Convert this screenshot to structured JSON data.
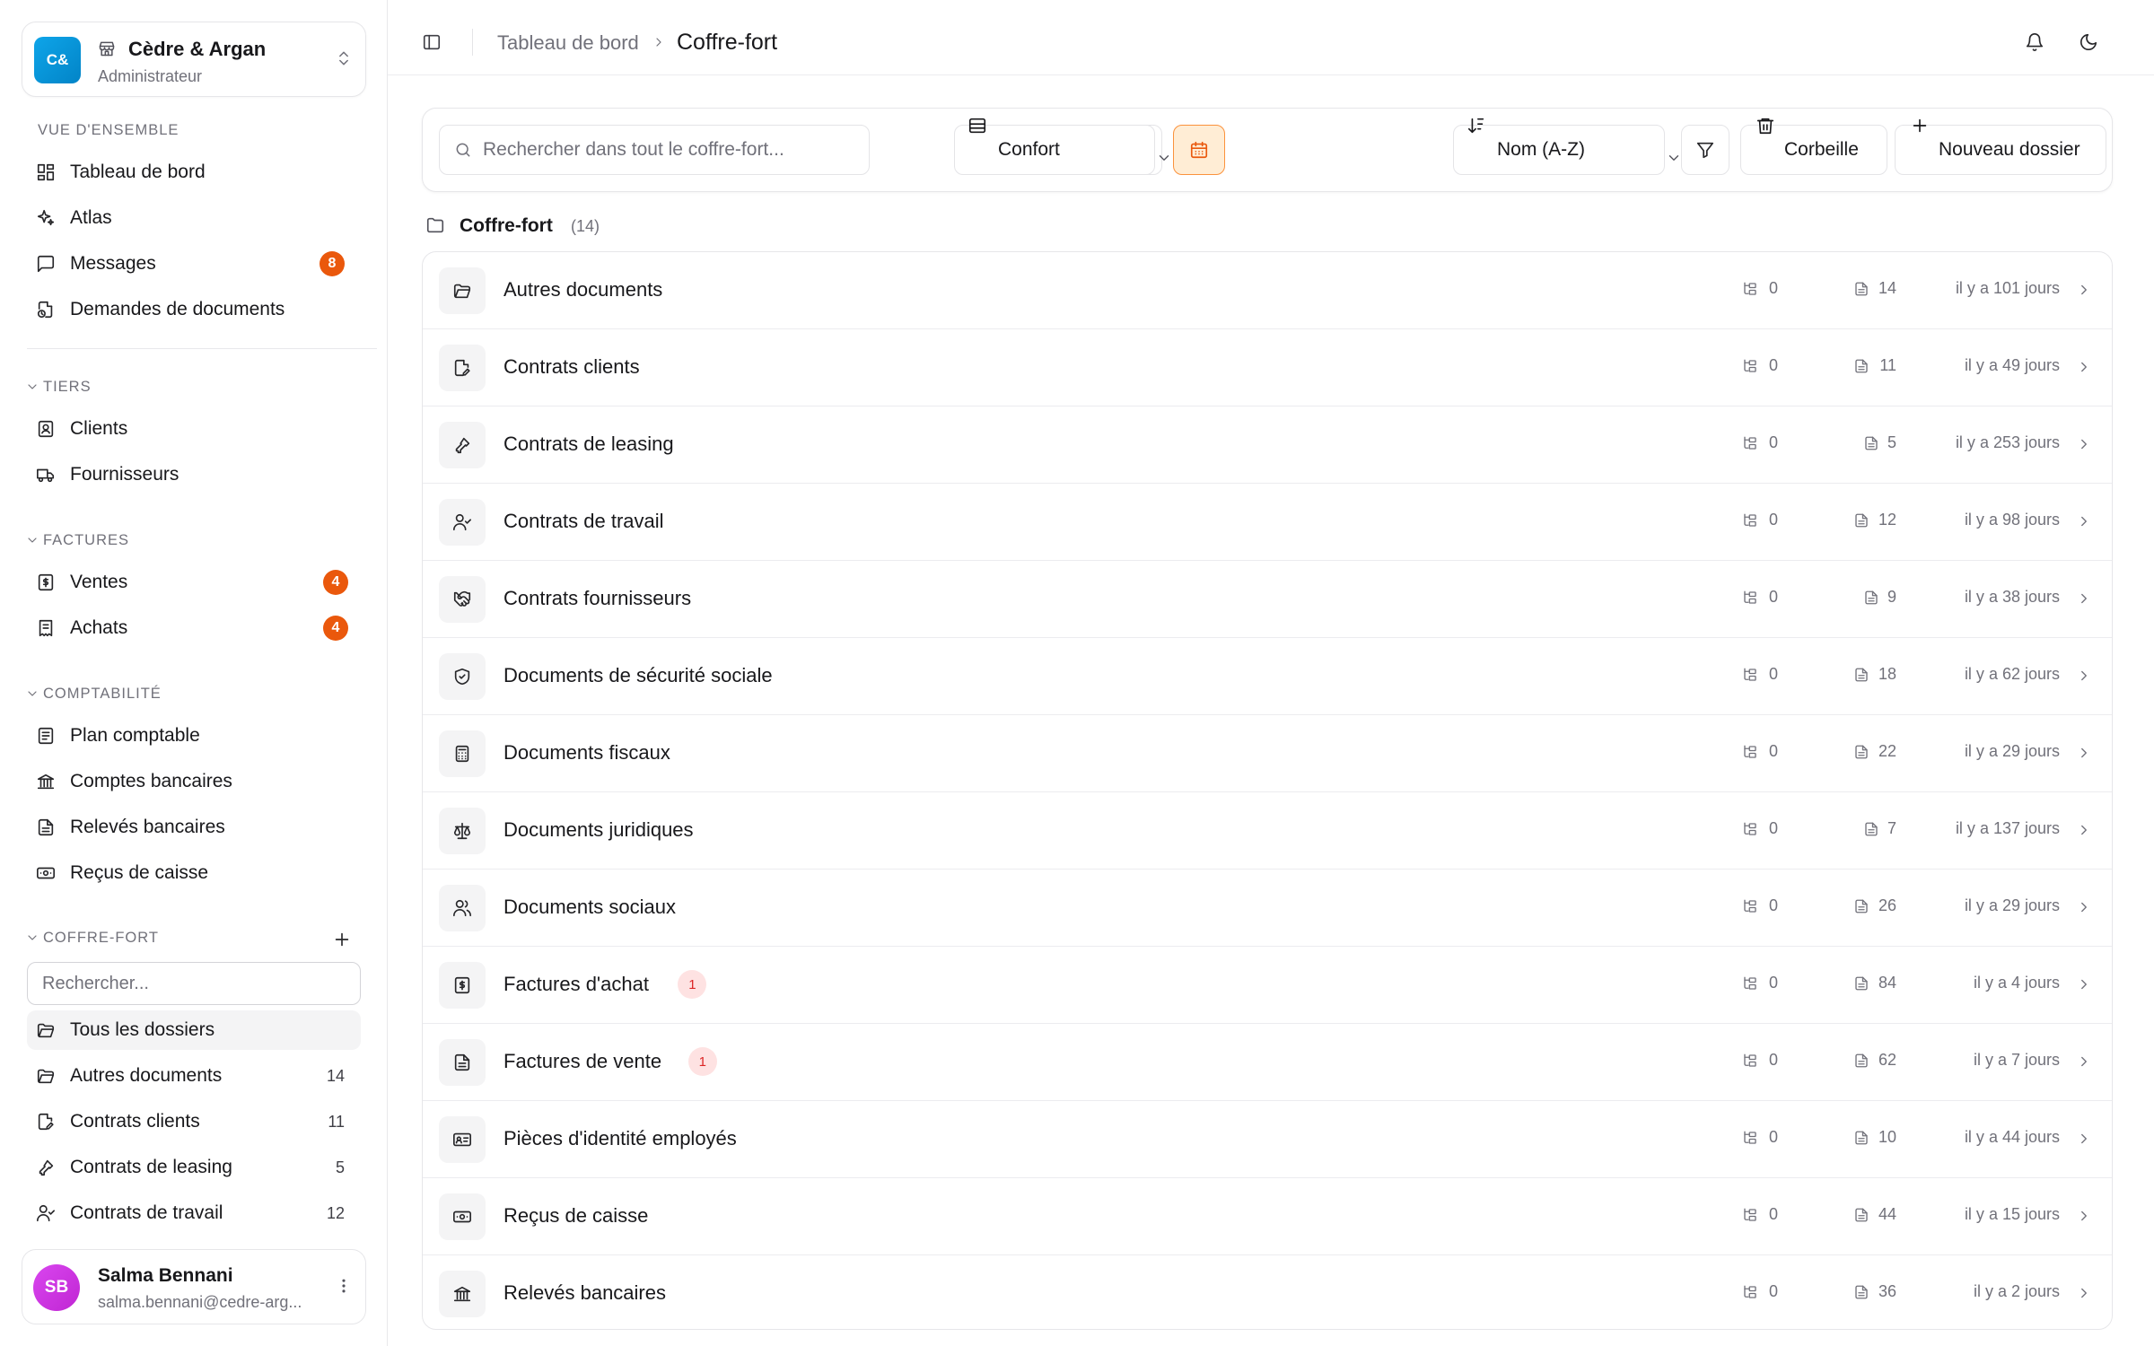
{
  "org": {
    "logo": "C&",
    "name": "Cèdre & Argan",
    "role": "Administrateur"
  },
  "sections": {
    "overview": "VUE D'ENSEMBLE",
    "tiers": "TIERS",
    "factures": "FACTURES",
    "comptabilite": "COMPTABILITÉ",
    "coffre": "COFFRE-FORT"
  },
  "nav": {
    "dashboard": "Tableau de bord",
    "atlas": "Atlas",
    "messages": "Messages",
    "messages_badge": "8",
    "demandes": "Demandes de documents",
    "clients": "Clients",
    "fournisseurs": "Fournisseurs",
    "ventes": "Ventes",
    "ventes_badge": "4",
    "achats": "Achats",
    "achats_badge": "4",
    "plan": "Plan comptable",
    "comptes": "Comptes bancaires",
    "releves": "Relevés bancaires",
    "recus": "Reçus de caisse"
  },
  "vault_nav": {
    "search_placeholder": "Rechercher...",
    "all": "Tous les dossiers",
    "items": [
      {
        "label": "Autres documents",
        "count": "14",
        "icon": "folder-open-icon"
      },
      {
        "label": "Contrats clients",
        "count": "11",
        "icon": "file-signature-icon"
      },
      {
        "label": "Contrats de leasing",
        "count": "5",
        "icon": "key-icon"
      },
      {
        "label": "Contrats de travail",
        "count": "12",
        "icon": "user-check-icon"
      }
    ]
  },
  "user": {
    "initials": "SB",
    "name": "Salma Bennani",
    "email": "salma.bennani@cedre-arg..."
  },
  "header": {
    "crumb_parent": "Tableau de bord",
    "crumb_current": "Coffre-fort"
  },
  "toolbar": {
    "search_placeholder": "Rechercher dans tout le coffre-fort...",
    "density": "Confort",
    "sort": "Nom (A-Z)",
    "trash": "Corbeille",
    "new_folder": "Nouveau dossier"
  },
  "folder_heading": {
    "title": "Coffre-fort",
    "count": "(14)"
  },
  "folders": [
    {
      "name": "Autres documents",
      "icon": "folder-open-icon",
      "subfolders": "0",
      "docs": "14",
      "updated": "il y a 101 jours",
      "badge": ""
    },
    {
      "name": "Contrats clients",
      "icon": "file-signature-icon",
      "subfolders": "0",
      "docs": "11",
      "updated": "il y a 49 jours",
      "badge": ""
    },
    {
      "name": "Contrats de leasing",
      "icon": "key-icon",
      "subfolders": "0",
      "docs": "5",
      "updated": "il y a 253 jours",
      "badge": ""
    },
    {
      "name": "Contrats de travail",
      "icon": "user-check-icon",
      "subfolders": "0",
      "docs": "12",
      "updated": "il y a 98 jours",
      "badge": ""
    },
    {
      "name": "Contrats fournisseurs",
      "icon": "handshake-icon",
      "subfolders": "0",
      "docs": "9",
      "updated": "il y a 38 jours",
      "badge": ""
    },
    {
      "name": "Documents de sécurité sociale",
      "icon": "shield-icon",
      "subfolders": "0",
      "docs": "18",
      "updated": "il y a 62 jours",
      "badge": ""
    },
    {
      "name": "Documents fiscaux",
      "icon": "calculator-icon",
      "subfolders": "0",
      "docs": "22",
      "updated": "il y a 29 jours",
      "badge": ""
    },
    {
      "name": "Documents juridiques",
      "icon": "scale-icon",
      "subfolders": "0",
      "docs": "7",
      "updated": "il y a 137 jours",
      "badge": ""
    },
    {
      "name": "Documents sociaux",
      "icon": "users-icon",
      "subfolders": "0",
      "docs": "26",
      "updated": "il y a 29 jours",
      "badge": ""
    },
    {
      "name": "Factures d'achat",
      "icon": "receipt-dollar-icon",
      "subfolders": "0",
      "docs": "84",
      "updated": "il y a 4 jours",
      "badge": "1"
    },
    {
      "name": "Factures de vente",
      "icon": "file-text-icon",
      "subfolders": "0",
      "docs": "62",
      "updated": "il y a 7 jours",
      "badge": "1"
    },
    {
      "name": "Pièces d'identité employés",
      "icon": "id-card-icon",
      "subfolders": "0",
      "docs": "10",
      "updated": "il y a 44 jours",
      "badge": ""
    },
    {
      "name": "Reçus de caisse",
      "icon": "banknote-icon",
      "subfolders": "0",
      "docs": "44",
      "updated": "il y a 15 jours",
      "badge": ""
    },
    {
      "name": "Relevés bancaires",
      "icon": "landmark-icon",
      "subfolders": "0",
      "docs": "36",
      "updated": "il y a 2 jours",
      "badge": ""
    }
  ],
  "colors": {
    "accent": "#ea580c",
    "badge_bg": "#fee2e2",
    "badge_fg": "#dc2626",
    "logo": "#0ea5e9",
    "avatar": "#d946ef"
  }
}
